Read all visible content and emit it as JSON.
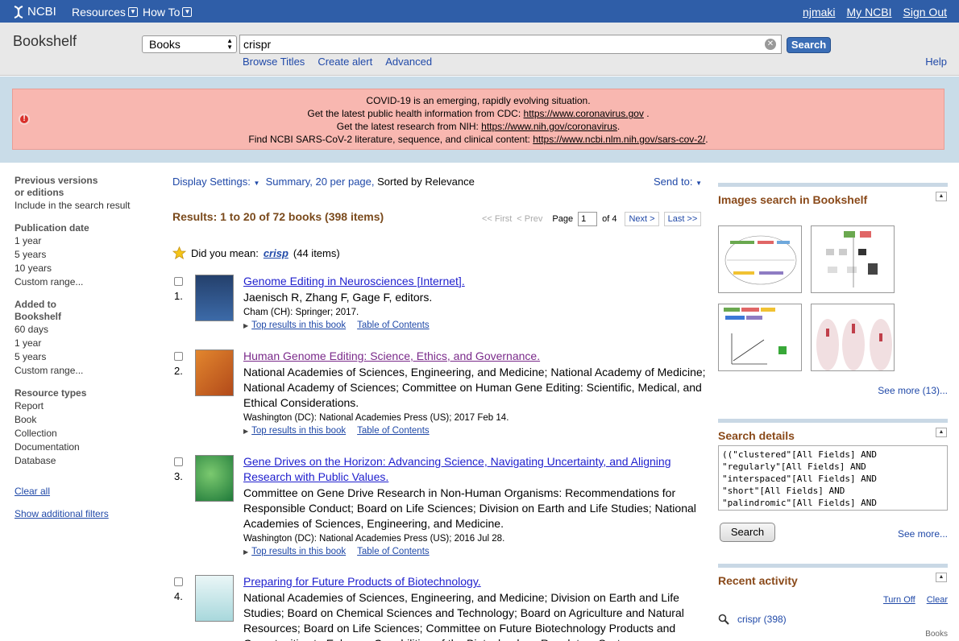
{
  "topbar": {
    "logo": "NCBI",
    "menus": [
      "Resources",
      "How To"
    ],
    "user_links": [
      "njmaki",
      "My NCBI",
      "Sign Out"
    ]
  },
  "search": {
    "db_title": "Bookshelf",
    "db_value": "Books",
    "term": "crispr",
    "button": "Search",
    "sublinks": [
      "Browse Titles",
      "Create alert",
      "Advanced"
    ],
    "help": "Help"
  },
  "alert": {
    "line1": "COVID-19 is an emerging, rapidly evolving situation.",
    "line2_text": "Get the latest public health information from CDC: ",
    "line2_link": "https://www.coronavirus.gov",
    "line2_tail": " .",
    "line3_text": "Get the latest research from NIH: ",
    "line3_link": "https://www.nih.gov/coronavirus",
    "line3_tail": ".",
    "line4_text": "Find NCBI SARS-CoV-2 literature, sequence, and clinical content: ",
    "line4_link": "https://www.ncbi.nlm.nih.gov/sars-cov-2/",
    "line4_tail": "."
  },
  "filters": {
    "groups": [
      {
        "title": "Previous versions or editions",
        "items": [
          "Include in the search result"
        ]
      },
      {
        "title": "Publication date",
        "items": [
          "1 year",
          "5 years",
          "10 years",
          "Custom range..."
        ]
      },
      {
        "title": "Added to Bookshelf",
        "items": [
          "60 days",
          "1 year",
          "5 years",
          "Custom range..."
        ]
      },
      {
        "title": "Resource types",
        "items": [
          "Report",
          "Book",
          "Collection",
          "Documentation",
          "Database"
        ]
      }
    ],
    "clear_all": "Clear all",
    "show_additional": "Show additional filters"
  },
  "results_header": {
    "display_settings": "Display Settings:",
    "display_value": "Summary, 20 per page,",
    "sorted": "Sorted by Relevance",
    "send_to": "Send to:",
    "count": "Results: 1 to 20 of 72 books (398 items)",
    "first": "<< First",
    "prev": "< Prev",
    "page_label": "Page",
    "page_value": "1",
    "of": "of 4",
    "next": "Next >",
    "last": "Last >>",
    "did_you_mean": "Did you mean:",
    "suggest": "crisp",
    "suggest_count": "(44 items)"
  },
  "results": [
    {
      "num": "1.",
      "title": "Genome Editing in Neurosciences [Internet].",
      "desc": "Jaenisch R, Zhang F, Gage F, editors.",
      "pub": "Cham (CH): Springer; 2017.",
      "link1": "Top results in this book",
      "link2": "Table of Contents",
      "thumb_color": "#24406c"
    },
    {
      "num": "2.",
      "title": "Human Genome Editing: Science, Ethics, and Governance.",
      "desc": "National Academies of Sciences, Engineering, and Medicine; National Academy of Medicine; National Academy of Sciences; Committee on Human Gene Editing: Scientific, Medical, and Ethical Considerations.",
      "pub": "Washington (DC): National Academies Press (US); 2017 Feb 14.",
      "link1": "Top results in this book",
      "link2": "Table of Contents",
      "thumb_color": "#d8702a"
    },
    {
      "num": "3.",
      "title": "Gene Drives on the Horizon: Advancing Science, Navigating Uncertainty, and Aligning Research with Public Values.",
      "desc": "Committee on Gene Drive Research in Non-Human Organisms: Recommendations for Responsible Conduct; Board on Life Sciences; Division on Earth and Life Studies; National Academies of Sciences, Engineering, and Medicine.",
      "pub": "Washington (DC): National Academies Press (US); 2016 Jul 28.",
      "link1": "Top results in this book",
      "link2": "Table of Contents",
      "thumb_color": "#2f8a4a"
    },
    {
      "num": "4.",
      "title": "Preparing for Future Products of Biotechnology.",
      "desc": "National Academies of Sciences, Engineering, and Medicine; Division on Earth and Life Studies; Board on Chemical Sciences and Technology; Board on Agriculture and Natural Resources; Board on Life Sciences; Committee on Future Biotechnology Products and Opportunities to Enhance Capabilities of the Biotechnology Regulatory System.",
      "pub": "",
      "link1": "",
      "link2": "",
      "thumb_color": "#9fd3d8"
    }
  ],
  "sidebar": {
    "images_title": "Images search in Bookshelf",
    "images_more": "See more (13)...",
    "details_title": "Search details",
    "details_text": "((\"clustered\"[All Fields] AND\n\"regularly\"[All Fields] AND\n\"interspaced\"[All Fields] AND\n\"short\"[All Fields] AND\n\"palindromic\"[All Fields] AND",
    "details_search": "Search",
    "details_more": "See more...",
    "recent_title": "Recent activity",
    "turn_off": "Turn Off",
    "clear": "Clear",
    "recent_query": "crispr (398)",
    "recent_kind": "Books"
  }
}
